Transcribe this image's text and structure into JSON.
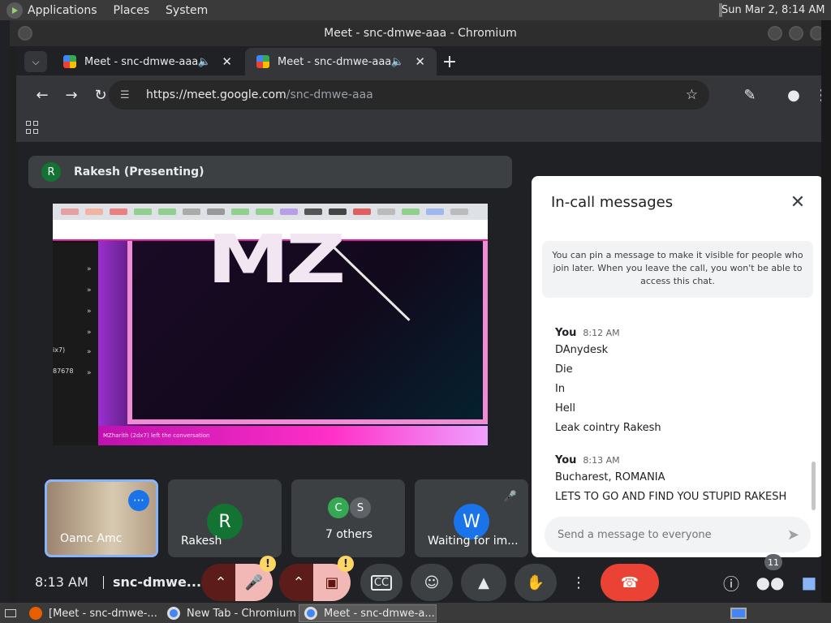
{
  "gnome": {
    "menu": [
      "Applications",
      "Places",
      "System"
    ],
    "clock": "Sun Mar 2, 8:14 AM"
  },
  "window": {
    "title": "Meet - snc-dmwe-aaa - Chromium"
  },
  "browser": {
    "tabs": [
      {
        "title": "Meet - snc-dmwe-aaa",
        "active": false
      },
      {
        "title": "Meet - snc-dmwe-aaa",
        "active": true
      }
    ],
    "url_host": "https://meet.google.com",
    "url_path": "/snc-dmwe-aaa"
  },
  "meet": {
    "presenter": {
      "initial": "R",
      "label": "Rakesh (Presenting)"
    },
    "shared_screen": {
      "logo_text": "MZ",
      "caption": "MZharith (2dx7) left the conversation",
      "side_items": [
        "ix7)",
        "87678"
      ]
    },
    "tiles": [
      {
        "label": "Oamc Amc",
        "type": "self"
      },
      {
        "label": "Rakesh",
        "initial": "R",
        "color": "#137333"
      },
      {
        "label": "7 others",
        "initials": [
          "C",
          "S"
        ],
        "colors": [
          "#34a853",
          "#5f6368"
        ]
      },
      {
        "label": "Waiting for im...",
        "initial": "W",
        "color": "#1a73e8"
      }
    ],
    "controls": {
      "time": "8:13 AM",
      "meeting_code": "snc-dmwe...",
      "people_count": "11"
    },
    "chat": {
      "header": "In-call messages",
      "note": "You can pin a message to make it visible for people who join later. When you leave the call, you won't be able to access this chat.",
      "groups": [
        {
          "sender": "You",
          "time": "8:12 AM",
          "lines": [
            "DAnydesk",
            "Die",
            "In",
            "Hell",
            "Leak cointry Rakesh"
          ]
        },
        {
          "sender": "You",
          "time": "8:13 AM",
          "lines": [
            "Bucharest, ROMANIA",
            "LETS TO GO AND FIND YOU STUPID RAKESH"
          ]
        }
      ],
      "placeholder": "Send a message to everyone"
    }
  },
  "taskbar": {
    "items": [
      {
        "label": "[Meet - snc-dmwe-...",
        "active": false
      },
      {
        "label": "New Tab - Chromium",
        "active": false
      },
      {
        "label": "Meet - snc-dmwe-a...",
        "active": true
      }
    ]
  },
  "colors": {
    "meet_bg": "#202124",
    "accent_blue": "#1a73e8",
    "end_call_red": "#ea4335",
    "warning_yellow": "#fdd663"
  }
}
